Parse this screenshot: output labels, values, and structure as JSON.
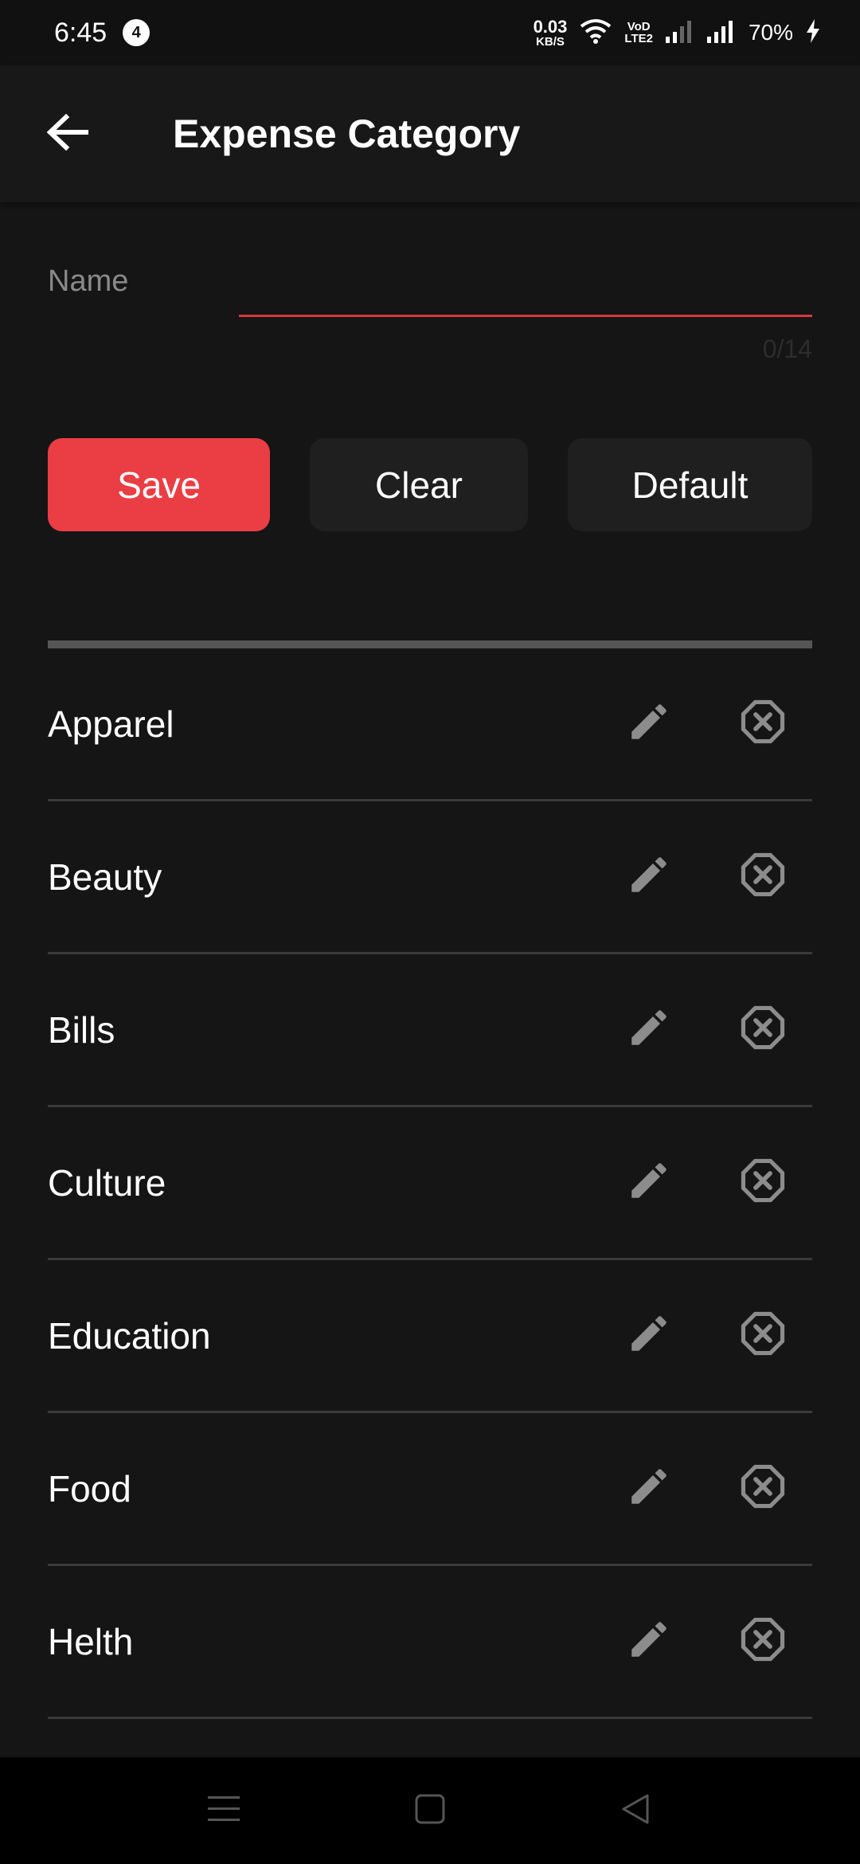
{
  "status_bar": {
    "time": "6:45",
    "notification_count": "4",
    "net_speed_value": "0.03",
    "net_speed_unit": "KB/S",
    "volte_top": "VoD",
    "volte_bottom": "LTE2",
    "battery": "70%",
    "icons": [
      "wifi-icon",
      "signal-icon",
      "signal-icon",
      "charging-icon"
    ]
  },
  "app_bar": {
    "title": "Expense Category",
    "back_icon": "arrow-left-icon"
  },
  "form": {
    "name_label": "Name",
    "name_value": "",
    "char_counter": "0/14",
    "accent_color": "#d9363e"
  },
  "buttons": {
    "save": "Save",
    "clear": "Clear",
    "default": "Default",
    "save_color": "#ea3e44"
  },
  "categories": [
    {
      "name": "Apparel"
    },
    {
      "name": "Beauty"
    },
    {
      "name": "Bills"
    },
    {
      "name": "Culture"
    },
    {
      "name": "Education"
    },
    {
      "name": "Food"
    },
    {
      "name": "Helth"
    }
  ],
  "row_icons": {
    "edit": "pencil-icon",
    "delete": "close-octagon-icon"
  },
  "nav_bar": {
    "icons": [
      "menu-icon",
      "home-square-icon",
      "back-triangle-icon"
    ]
  }
}
